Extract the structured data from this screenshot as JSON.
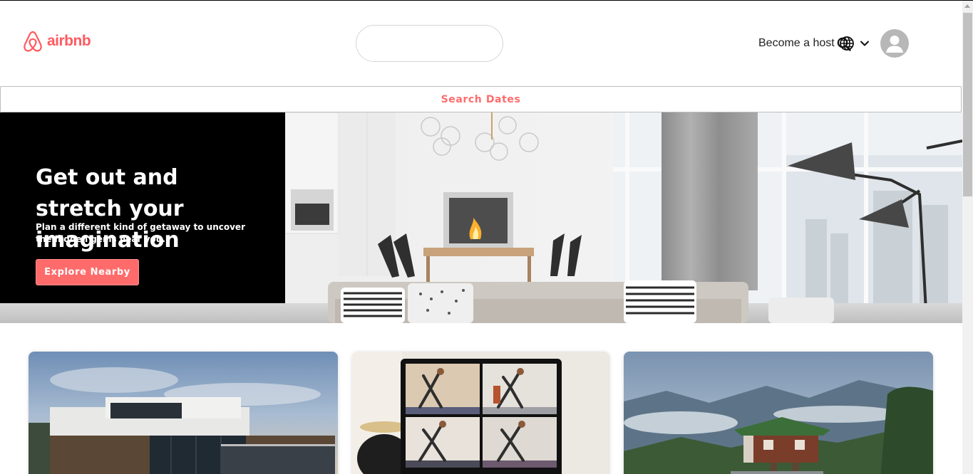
{
  "header": {
    "logo_text": "airbnb",
    "search": {
      "value": "",
      "placeholder": ""
    },
    "become_host_label": "Become a host"
  },
  "dates_bar": {
    "label": "Search Dates"
  },
  "hero": {
    "title": "Get out and stretch your imagination",
    "subtitle": "Plan a different kind of getaway to uncover the hidden gems near you.",
    "button_label": "Explore Nearby"
  },
  "icons": {
    "logo": "airbnb-logo-icon",
    "search": "search-icon",
    "globe": "globe-icon",
    "dropdown": "chevron-down-icon",
    "avatar": "user-avatar-icon"
  },
  "colors": {
    "brand": "#ff5a5f",
    "button": "#ff6b6b",
    "hero_panel": "#000000"
  }
}
